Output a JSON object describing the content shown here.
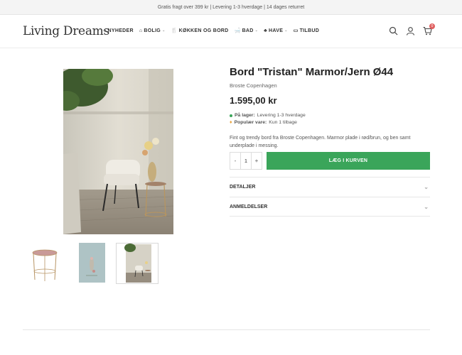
{
  "topbar": {
    "text": "Gratis fragt over 399 kr | Levering 1-3 hverdage | 14 dages returret"
  },
  "header": {
    "logo": "Living Dreams",
    "nav": [
      {
        "label": "NYHEDER",
        "icon": "circle-icon",
        "has_dropdown": false
      },
      {
        "label": "BOLIG",
        "icon": "home-icon",
        "has_dropdown": true
      },
      {
        "label": "KØKKEN OG BORD",
        "icon": "cutlery-icon",
        "has_dropdown": false
      },
      {
        "label": "BAD",
        "icon": "bath-icon",
        "has_dropdown": true
      },
      {
        "label": "HAVE",
        "icon": "garden-icon",
        "has_dropdown": true
      },
      {
        "label": "TILBUD",
        "icon": "tag-icon",
        "has_dropdown": false
      }
    ],
    "icons": [
      "search-icon",
      "user-icon",
      "cart-icon"
    ],
    "cart_count": "0"
  },
  "product": {
    "title": "Bord \"Tristan\" Marmor/Jern Ø44",
    "brand": "Broste Copenhagen",
    "price": "1.595,00 kr",
    "stock_label": "På lager:",
    "stock_text": "Levering 1-3 hverdage",
    "popular_label": "Populær vare:",
    "popular_text": "Kun 1 tilbage",
    "description": "Fint og trendy bord fra Broste Copenhagen. Marmor plade i rød/brun, og ben samt underplade i messing.",
    "quantity": "1",
    "minus": "-",
    "plus": "+",
    "add_to_cart": "LÆG I KURVEN"
  },
  "accordion": [
    {
      "label": "DETALJER"
    },
    {
      "label": "ANMELDELSER"
    }
  ],
  "colors": {
    "accent": "#3aa55a",
    "badge": "#e06060",
    "stock_dot": "#3aa55a",
    "popular_icon": "#e8a33c"
  }
}
